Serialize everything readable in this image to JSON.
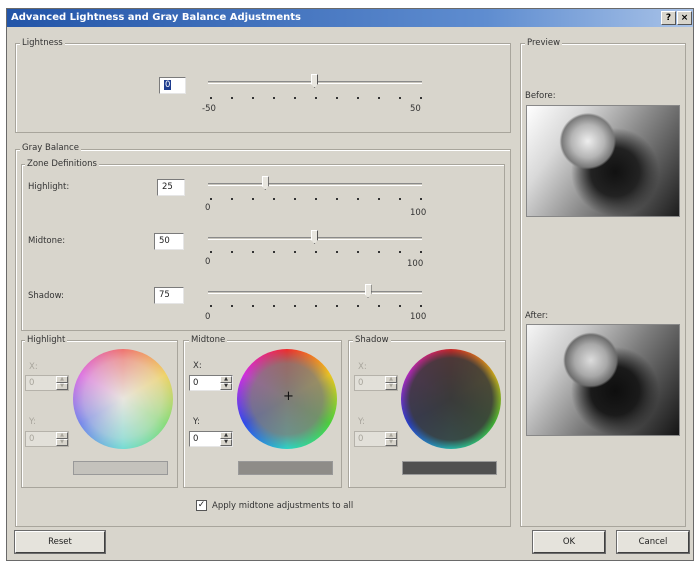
{
  "window": {
    "title": "Advanced Lightness and Gray Balance Adjustments",
    "help_label": "?",
    "close_label": "×"
  },
  "lightness": {
    "group_label": "Lightness",
    "value": "0",
    "min_label": "-50",
    "max_label": "50",
    "level": 0.5
  },
  "gray_balance": {
    "group_label": "Gray Balance",
    "zone_label": "Zone Definitions",
    "highlight": {
      "label": "Highlight:",
      "value": "25",
      "min_label": "0",
      "max_label": "100",
      "level": 0.27
    },
    "midtone": {
      "label": "Midtone:",
      "value": "50",
      "min_label": "0",
      "max_label": "100",
      "level": 0.5
    },
    "shadow": {
      "label": "Shadow:",
      "value": "75",
      "min_label": "0",
      "max_label": "100",
      "level": 0.75
    }
  },
  "wheels": {
    "highlight": {
      "label": "Highlight",
      "x_label": "X:",
      "y_label": "Y:",
      "x_value": "0",
      "y_value": "0",
      "swatch_color": "#c4c2bc"
    },
    "midtone": {
      "label": "Midtone",
      "x_label": "X:",
      "y_label": "Y:",
      "x_value": "0",
      "y_value": "0",
      "swatch_color": "#8e8c88"
    },
    "shadow": {
      "label": "Shadow",
      "x_label": "X:",
      "y_label": "Y:",
      "x_value": "0",
      "y_value": "0",
      "swatch_color": "#505050"
    }
  },
  "apply_all": {
    "label": "Apply midtone adjustments to all",
    "checked": true
  },
  "preview": {
    "group_label": "Preview",
    "before_label": "Before:",
    "after_label": "After:"
  },
  "buttons": {
    "reset": "Reset",
    "ok": "OK",
    "cancel": "Cancel"
  }
}
